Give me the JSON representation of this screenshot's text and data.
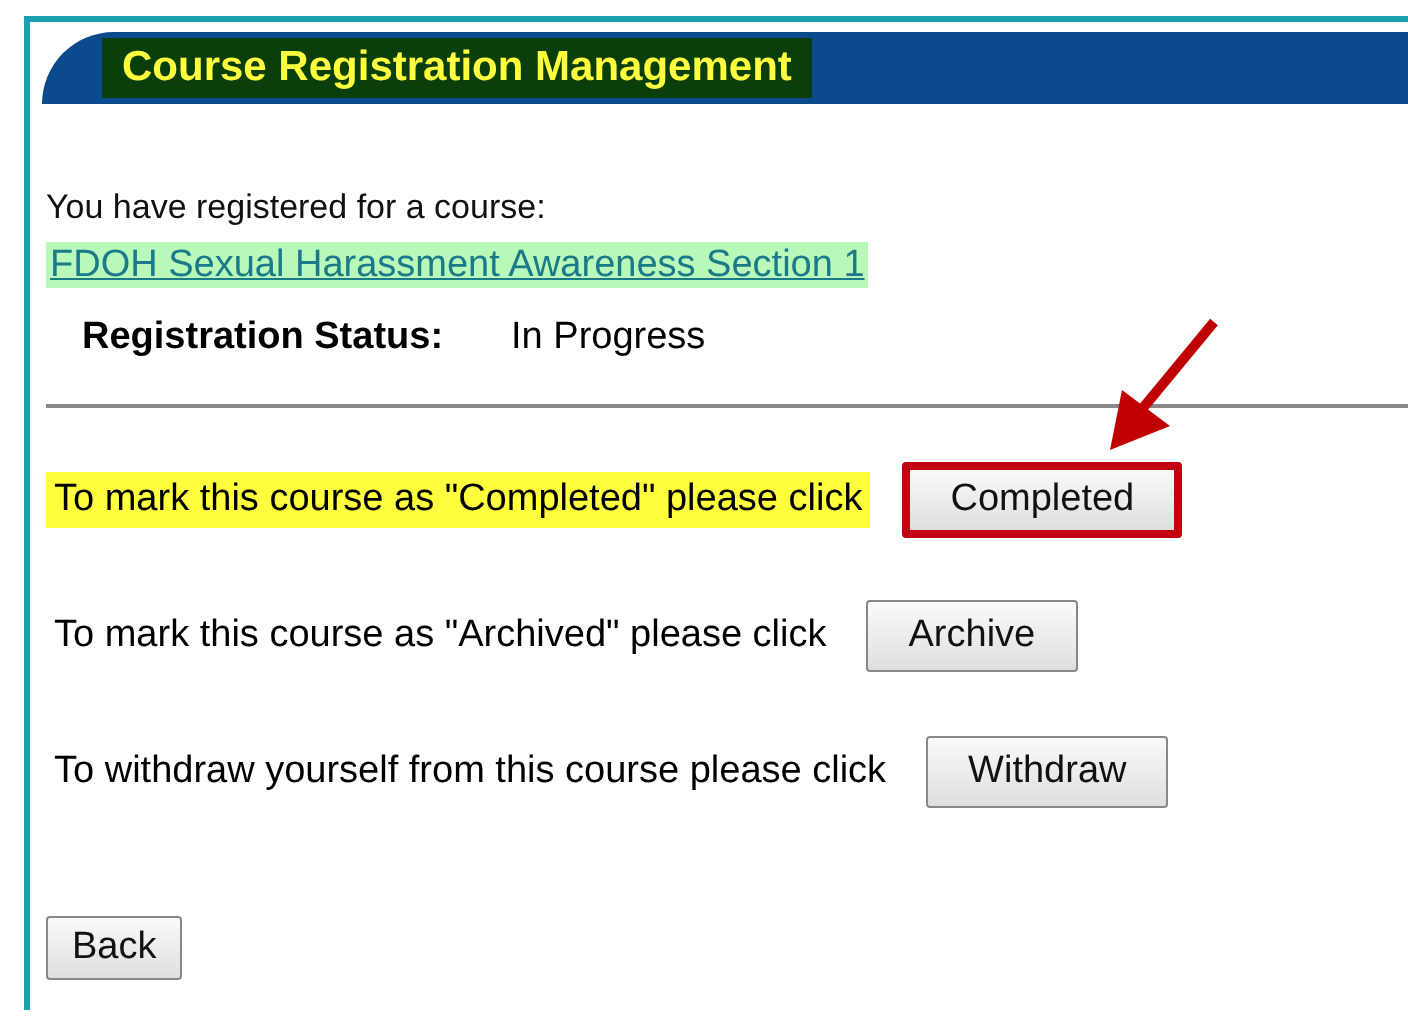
{
  "header": {
    "title": "Course Registration Management"
  },
  "intro": "You have registered for a course:",
  "course_link": "FDOH Sexual Harassment Awareness Section 1",
  "status": {
    "label": "Registration Status:",
    "value": "In Progress"
  },
  "actions": [
    {
      "text": "To mark this course as \"Completed\" please click",
      "button": "Completed",
      "highlighted": true
    },
    {
      "text": "To mark this course as \"Archived\" please click",
      "button": "Archive",
      "highlighted": false
    },
    {
      "text": "To withdraw yourself from this course please click",
      "button": "Withdraw",
      "highlighted": false
    }
  ],
  "back_button": "Back"
}
